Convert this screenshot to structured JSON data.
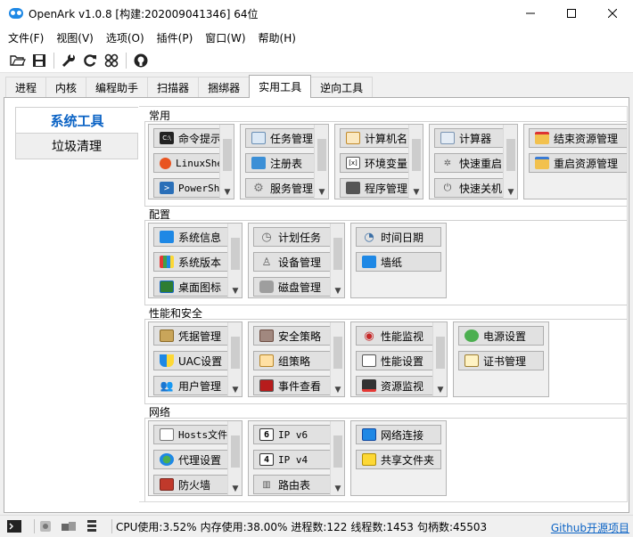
{
  "window": {
    "title": "OpenArk v1.0.8  [构建:202009041346]  64位",
    "controls": {
      "minimize": "─",
      "maximize": "☐",
      "close": "✕"
    }
  },
  "menu": [
    "文件(F)",
    "视图(V)",
    "选项(O)",
    "插件(P)",
    "窗口(W)",
    "帮助(H)"
  ],
  "toolbar": {
    "icons": [
      "open-folder-icon",
      "save-icon",
      "wrench-icon",
      "refresh-icon",
      "grid-icon",
      "github-icon"
    ]
  },
  "tabs": [
    {
      "label": "进程",
      "active": false
    },
    {
      "label": "内核",
      "active": false
    },
    {
      "label": "编程助手",
      "active": false
    },
    {
      "label": "扫描器",
      "active": false
    },
    {
      "label": "捆绑器",
      "active": false
    },
    {
      "label": "实用工具",
      "active": true
    },
    {
      "label": "逆向工具",
      "active": false
    }
  ],
  "sidebar": {
    "items": [
      {
        "label": "系统工具",
        "active": true
      },
      {
        "label": "垃圾清理",
        "active": false
      }
    ]
  },
  "sections": {
    "common": {
      "title": "常用",
      "groups": [
        [
          "命令提示",
          "LinuxShe",
          "PowerShe"
        ],
        [
          "任务管理",
          "注册表",
          "服务管理"
        ],
        [
          "计算机名",
          "环境变量",
          "程序管理"
        ],
        [
          "计算器",
          "快速重启",
          "快速关机"
        ],
        [
          "结束资源管理",
          "重启资源管理"
        ]
      ]
    },
    "config": {
      "title": "配置",
      "groups": [
        [
          "系统信息",
          "系统版本",
          "桌面图标"
        ],
        [
          "计划任务",
          "设备管理",
          "磁盘管理"
        ],
        [
          "时间日期",
          "墙纸"
        ]
      ]
    },
    "perf": {
      "title": "性能和安全",
      "groups": [
        [
          "凭据管理",
          "UAC设置",
          "用户管理"
        ],
        [
          "安全策略",
          "组策略",
          "事件查看"
        ],
        [
          "性能监视",
          "性能设置",
          "资源监视"
        ],
        [
          "电源设置",
          "证书管理"
        ]
      ]
    },
    "network": {
      "title": "网络",
      "groups": [
        [
          "Hosts文件",
          "代理设置",
          "防火墙"
        ],
        [
          "IP v6",
          "IP v4",
          "路由表"
        ],
        [
          "网络连接",
          "共享文件夹"
        ]
      ]
    }
  },
  "status": {
    "cpu": "CPU使用:3.52%",
    "mem": "内存使用:38.00%",
    "procs": "进程数:122",
    "threads": "线程数:1453",
    "handles": "句柄数:45503",
    "github": "Github开源项目"
  }
}
